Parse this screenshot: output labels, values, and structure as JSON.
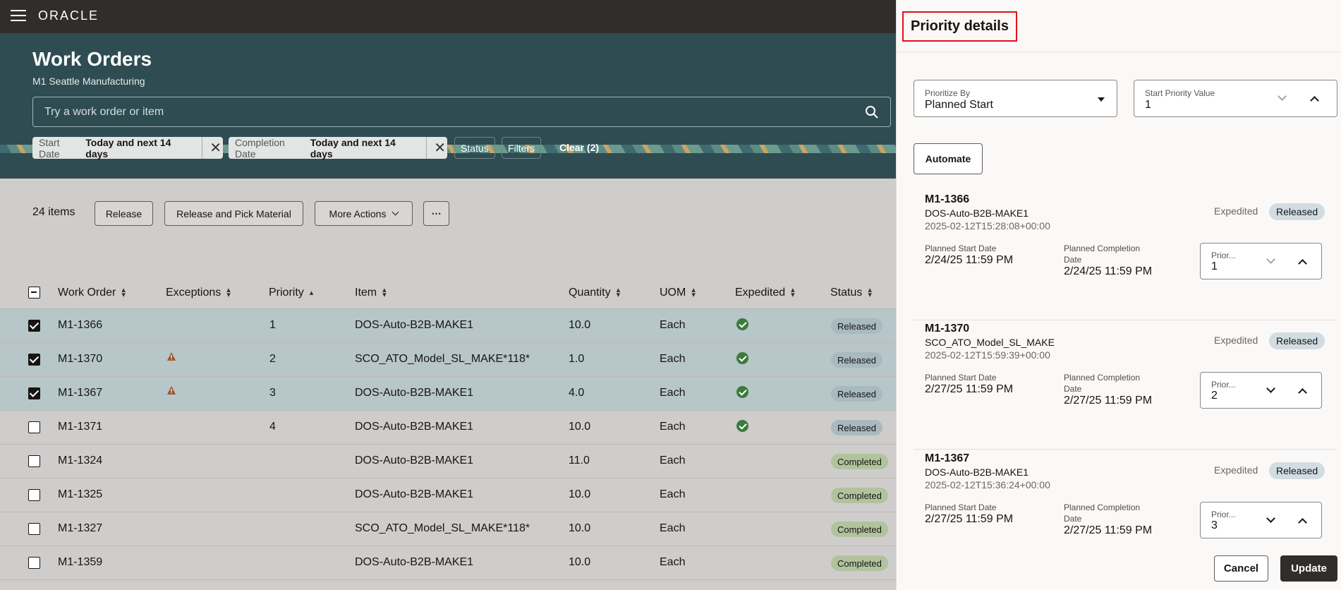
{
  "app": {
    "logo": "ORACLE"
  },
  "header": {
    "title": "Work Orders",
    "subtitle": "M1 Seattle Manufacturing",
    "search_placeholder": "Try a work order or item"
  },
  "filters": {
    "chips": [
      {
        "label": "Start Date",
        "value": "Today and next 14 days"
      },
      {
        "label": "Completion Date",
        "value": "Today and next 14 days"
      }
    ],
    "status": "Status",
    "filters": "Filters",
    "clear": "Clear (2)"
  },
  "toolbar": {
    "count": "24 items",
    "release": "Release",
    "release_pick": "Release and Pick Material",
    "more_actions": "More Actions",
    "overflow": "⋯"
  },
  "table": {
    "columns": {
      "work_order": "Work Order",
      "exceptions": "Exceptions",
      "priority": "Priority",
      "item": "Item",
      "quantity": "Quantity",
      "uom": "UOM",
      "expedited": "Expedited",
      "status": "Status"
    },
    "rows": [
      {
        "wo": "M1-1366",
        "priority": "1",
        "item": "DOS-Auto-B2B-MAKE1",
        "qty": "10.0",
        "uom": "Each",
        "status": "Released"
      },
      {
        "wo": "M1-1370",
        "priority": "2",
        "item": "SCO_ATO_Model_SL_MAKE*118*",
        "qty": "1.0",
        "uom": "Each",
        "status": "Released"
      },
      {
        "wo": "M1-1367",
        "priority": "3",
        "item": "DOS-Auto-B2B-MAKE1",
        "qty": "4.0",
        "uom": "Each",
        "status": "Released"
      },
      {
        "wo": "M1-1371",
        "priority": "4",
        "item": "DOS-Auto-B2B-MAKE1",
        "qty": "10.0",
        "uom": "Each",
        "status": "Released"
      },
      {
        "wo": "M1-1324",
        "priority": "",
        "item": "DOS-Auto-B2B-MAKE1",
        "qty": "11.0",
        "uom": "Each",
        "status": "Completed"
      },
      {
        "wo": "M1-1325",
        "priority": "",
        "item": "DOS-Auto-B2B-MAKE1",
        "qty": "10.0",
        "uom": "Each",
        "status": "Completed"
      },
      {
        "wo": "M1-1327",
        "priority": "",
        "item": "SCO_ATO_Model_SL_MAKE*118*",
        "qty": "10.0",
        "uom": "Each",
        "status": "Completed"
      },
      {
        "wo": "M1-1359",
        "priority": "",
        "item": "DOS-Auto-B2B-MAKE1",
        "qty": "10.0",
        "uom": "Each",
        "status": "Completed"
      }
    ]
  },
  "drawer": {
    "title": "Priority details",
    "prioritize_by": {
      "label": "Prioritize By",
      "value": "Planned Start"
    },
    "start_priority": {
      "label": "Start Priority Value",
      "value": "1"
    },
    "automate": "Automate",
    "cards": [
      {
        "id": "M1-1366",
        "item": "DOS-Auto-B2B-MAKE1",
        "ts": "2025-02-12T15:28:08+00:00",
        "expedited": "Expedited",
        "status": "Released",
        "start_label": "Planned Start Date",
        "start": "2/24/25 11:59 PM",
        "comp_label_1": "Planned Completion",
        "comp_label_2": "Date",
        "comp": "2/24/25 11:59 PM",
        "prio_label": "Prior...",
        "prio": "1"
      },
      {
        "id": "M1-1370",
        "item": "SCO_ATO_Model_SL_MAKE",
        "ts": "2025-02-12T15:59:39+00:00",
        "expedited": "Expedited",
        "status": "Released",
        "start_label": "Planned Start Date",
        "start": "2/27/25 11:59 PM",
        "comp_label_1": "Planned Completion",
        "comp_label_2": "Date",
        "comp": "2/27/25 11:59 PM",
        "prio_label": "Prior...",
        "prio": "2"
      },
      {
        "id": "M1-1367",
        "item": "DOS-Auto-B2B-MAKE1",
        "ts": "2025-02-12T15:36:24+00:00",
        "expedited": "Expedited",
        "status": "Released",
        "start_label": "Planned Start Date",
        "start": "2/27/25 11:59 PM",
        "comp_label_1": "Planned Completion",
        "comp_label_2": "Date",
        "comp": "2/27/25 11:59 PM",
        "prio_label": "Prior...",
        "prio": "3"
      }
    ],
    "cancel": "Cancel",
    "update": "Update"
  },
  "colors": {
    "topbar": "#312d2a",
    "hero": "#2e4c52",
    "highlight": "#e0101a"
  }
}
